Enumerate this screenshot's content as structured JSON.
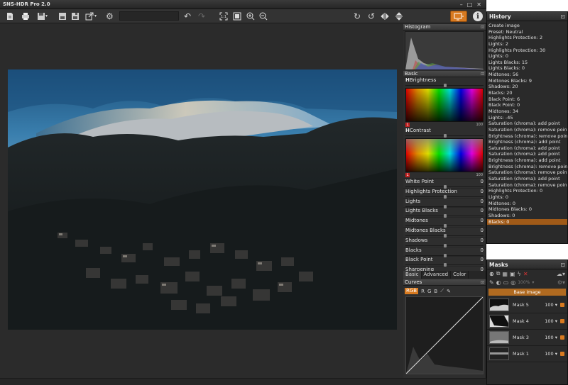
{
  "app": {
    "title": "SNS-HDR Pro 2.0"
  },
  "colors": {
    "accent": "#d87a20",
    "background": "#2b2b2b",
    "selected": "#a05a18"
  },
  "toolbar": {
    "icons": [
      "new-file-icon",
      "print-icon",
      "save-icon",
      "save-as-icon",
      "export-icon",
      "settings-gear-icon",
      "undo-icon",
      "redo-icon",
      "fit-icon",
      "fullscreen-icon",
      "zoom-in-icon",
      "zoom-out-icon",
      "rotate-right-icon",
      "rotate-left-icon",
      "flip-horizontal-icon",
      "flip-vertical-icon",
      "monitor-icon",
      "info-icon"
    ],
    "info_label": "i"
  },
  "right_panel": {
    "histogram_title": "Histogram",
    "basic_title": "Basic",
    "brightness": {
      "tag": "H",
      "label": "Brightness"
    },
    "contrast": {
      "tag": "H",
      "label": "Contrast"
    },
    "colorbox_L": "L",
    "colorbox_max": "100",
    "sliders": [
      {
        "label": "White Point",
        "value": "0"
      },
      {
        "label": "Highlights Protection",
        "value": "0"
      },
      {
        "label": "Lights",
        "value": "0"
      },
      {
        "label": "Lights Blacks",
        "value": "0"
      },
      {
        "label": "Midtones",
        "value": "0"
      },
      {
        "label": "Midtones Blacks",
        "value": "0"
      },
      {
        "label": "Shadows",
        "value": "0"
      },
      {
        "label": "Blacks",
        "value": "0"
      },
      {
        "label": "Black Point",
        "value": "0"
      },
      {
        "label": "Sharpening",
        "value": "0"
      }
    ],
    "tabs": [
      "Basic",
      "Advanced",
      "Color"
    ],
    "curves_title": "Curves",
    "curves_channels": [
      "RGB",
      "R",
      "G",
      "B"
    ]
  },
  "history": {
    "title": "History",
    "items": [
      "Create image",
      "Preset: Neutral",
      "Highlights Protection: 2",
      "Lights: 2",
      "Highlights Protection: 30",
      "Lights: 0",
      "Lights Blacks: 15",
      "Lights Blacks: 0",
      "Midtones: 56",
      "Midtones Blacks: 9",
      "Shadows: 20",
      "Blacks: 20",
      "Black Point: 6",
      "Black Point: 0",
      "Midtones: 34",
      "Lights: -45",
      "Saturation (chroma): add point",
      "Saturation (chroma): remove point",
      "Brightness (chroma): remove point",
      "Brightness (chroma): add point",
      "Saturation (chroma): add point",
      "Saturation (chroma): add point",
      "Brightness (chroma): add point",
      "Brightness (chroma): remove point",
      "Saturation (chroma): remove point",
      "Saturation (chroma): add point",
      "Saturation (chroma): remove point",
      "Highlights Protection: 0",
      "Lights: 0",
      "Midtones: 0",
      "Midtones Blacks: 0",
      "Shadows: 0",
      "Blacks: 0"
    ],
    "selected_index": 32
  },
  "masks": {
    "title": "Masks",
    "zoom": "100%",
    "base_label": "Base image",
    "items": [
      {
        "name": "Mask 5",
        "value": "100 ▾"
      },
      {
        "name": "Mask 4",
        "value": "100 ▾"
      },
      {
        "name": "Mask 3",
        "value": "100 ▾"
      },
      {
        "name": "Mask 1",
        "value": "100 ▾"
      }
    ]
  }
}
